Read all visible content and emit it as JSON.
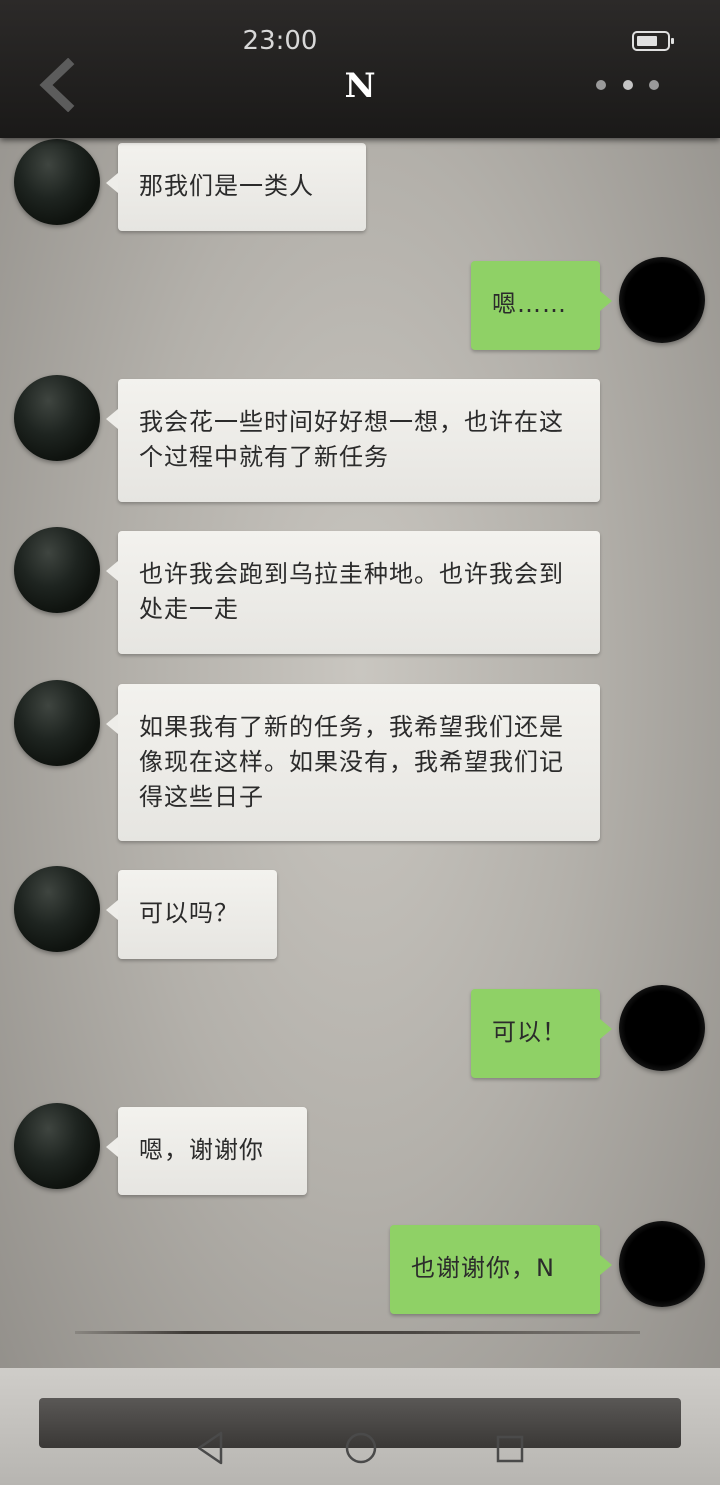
{
  "status_bar": {
    "time": "23:00"
  },
  "header": {
    "title": "N"
  },
  "messages": [
    {
      "side": "in",
      "text": "那我们是一类人"
    },
    {
      "side": "out",
      "text": "嗯……"
    },
    {
      "side": "in",
      "text": "我会花一些时间好好想一想，也许在这个过程中就有了新任务"
    },
    {
      "side": "in",
      "text": "也许我会跑到乌拉圭种地。也许我会到处走一走"
    },
    {
      "side": "in",
      "text": "如果我有了新的任务，我希望我们还是像现在这样。如果没有，我希望我们记得这些日子"
    },
    {
      "side": "in",
      "text": "可以吗？"
    },
    {
      "side": "out",
      "text": "可以！"
    },
    {
      "side": "in",
      "text": "嗯，谢谢你"
    },
    {
      "side": "out",
      "text": "也谢谢你，N"
    }
  ],
  "colors": {
    "header_bg": "#1f1e1d",
    "incoming_bubble": "#efeeea",
    "outgoing_bubble": "#8fd166",
    "input_bar": "#4a4846"
  },
  "icons": {
    "back": "chevron-left-icon",
    "more": "more-dots-icon",
    "battery": "battery-icon",
    "nav_back": "nav-back-icon",
    "nav_home": "nav-home-icon",
    "nav_recent": "nav-recent-icon"
  }
}
